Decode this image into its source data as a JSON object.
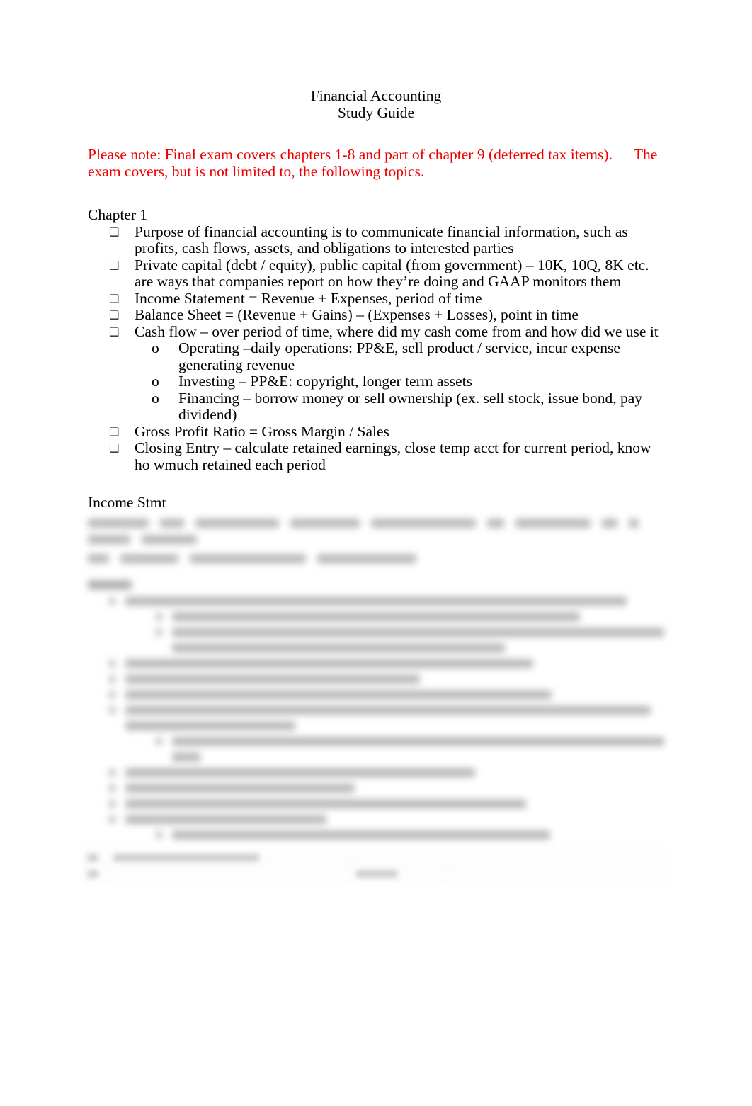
{
  "document": {
    "title_lines": [
      "Financial Accounting",
      "Study Guide"
    ],
    "note": {
      "part1": "Please note: Final exam covers chapters 1-8 and part of chapter 9 (deferred tax items).",
      "part2": "The exam covers, but is not limited to, the following topics.",
      "color": "#ee0000"
    },
    "chapter1": {
      "heading": "Chapter 1",
      "bullet_marker": "❑",
      "sub_marker": "o",
      "items": [
        {
          "text": "Purpose of financial accounting is to communicate financial information, such as profits, cash flows, assets, and obligations to interested parties"
        },
        {
          "text": "Private capital (debt / equity), public capital (from government) – 10K, 10Q, 8K etc. are ways that companies report on how they’re doing and GAAP monitors them"
        },
        {
          "text": "Income Statement = Revenue + Expenses, period of time"
        },
        {
          "text": "Balance Sheet = (Revenue + Gains) – (Expenses + Losses), point in time"
        },
        {
          "text": "Cash flow – over period of time, where did my cash come from and how did we use it",
          "subitems": [
            "Operating –daily operations:  PP&E, sell product / service, incur expense generating revenue",
            "Investing – PP&E: copyright, longer term assets",
            "Financing – borrow money or sell ownership (ex. sell stock, issue bond, pay dividend)"
          ]
        },
        {
          "text": "Gross Profit Ratio = Gross Margin / Sales"
        },
        {
          "text": "Closing Entry – calculate retained earnings, close temp acct for current period, know ho wmuch retained each period"
        }
      ]
    },
    "income_stmt": {
      "heading": "Income Stmt"
    },
    "redacted": {
      "label": "blurred-preview-content"
    }
  }
}
